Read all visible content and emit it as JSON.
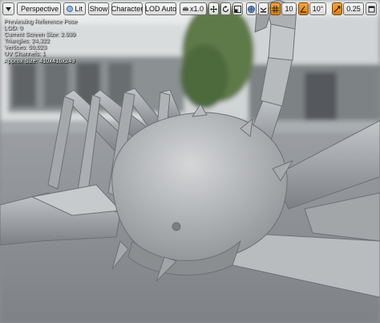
{
  "toolbar": {
    "perspective_label": "Perspective",
    "lit_label": "Lit",
    "show_label": "Show",
    "character_label": "Character",
    "lod_label": "LOD Auto",
    "speed_label": "x1.0",
    "grid_snap_value": "10",
    "rotation_snap_value": "10°",
    "scale_snap_value": "0.25"
  },
  "info": {
    "line1": "Previewing Reference Pose",
    "line2": "LOD: 0",
    "line3": "Current Screen Size: 2.939",
    "line4": "Triangles: 24,322",
    "line5": "Vertices: 50,023",
    "line6": "UV Channels: 1",
    "line7": "Approx Size: 410x416x249"
  },
  "colors": {
    "accent_orange": "#e8921f",
    "toolbar_bg": "#e6e6e6",
    "info_text": "#ffffff"
  }
}
